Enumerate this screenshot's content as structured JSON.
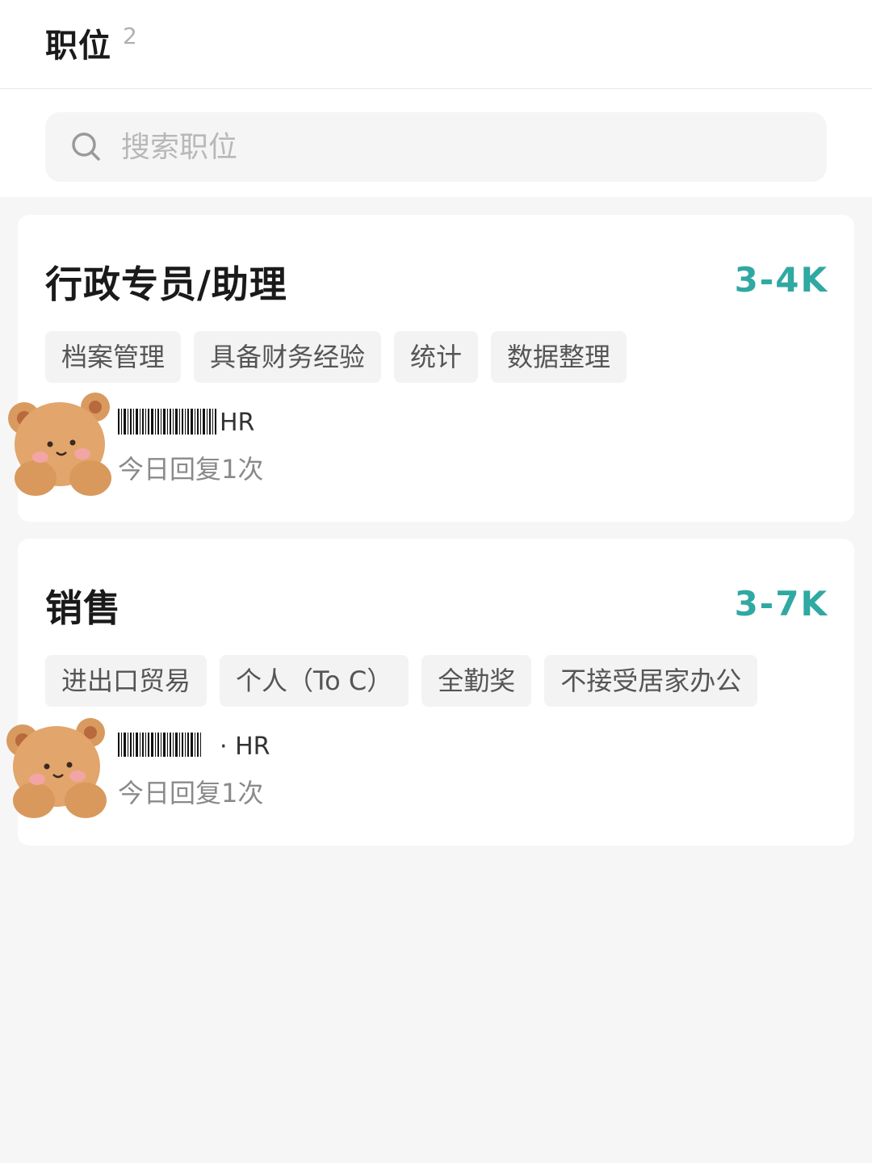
{
  "header": {
    "title": "职位",
    "count": "2"
  },
  "search": {
    "placeholder": "搜索职位"
  },
  "jobs": [
    {
      "title": "行政专员/助理",
      "salary": "3-4K",
      "tags": [
        "档案管理",
        "具备财务经验",
        "统计",
        "数据整理"
      ],
      "recruiter_title": "HR",
      "reply": "今日回复1次"
    },
    {
      "title": "销售",
      "salary": "3-7K",
      "tags": [
        "进出口贸易",
        "个人（To C）",
        "全勤奖",
        "不接受居家办公"
      ],
      "recruiter_title": "· HR",
      "reply": "今日回复1次"
    }
  ],
  "colors": {
    "accent": "#2fa9a1",
    "background": "#f6f6f6",
    "card": "#ffffff",
    "tag_bg": "#f3f3f3"
  },
  "icons": {
    "search": "search-icon",
    "avatar": "bear-avatar-icon"
  }
}
